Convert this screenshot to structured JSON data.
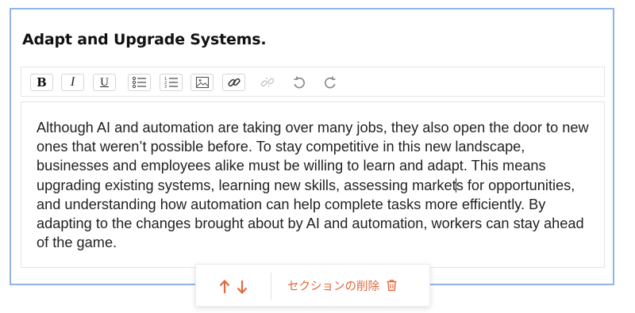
{
  "section": {
    "title": "Adapt and Upgrade Systems."
  },
  "toolbar": {
    "buttons": [
      {
        "name": "bold-button",
        "icon": "bold-icon",
        "label": "B"
      },
      {
        "name": "italic-button",
        "icon": "italic-icon",
        "label": "I"
      },
      {
        "name": "underline-button",
        "icon": "underline-icon",
        "label": "U"
      },
      {
        "name": "bullet-list-button",
        "icon": "bullet-list-icon"
      },
      {
        "name": "numbered-list-button",
        "icon": "numbered-list-icon"
      },
      {
        "name": "insert-image-button",
        "icon": "image-icon"
      },
      {
        "name": "insert-link-button",
        "icon": "link-icon"
      },
      {
        "name": "remove-link-button",
        "icon": "unlink-icon",
        "disabled": true
      },
      {
        "name": "undo-button",
        "icon": "undo-icon"
      },
      {
        "name": "redo-button",
        "icon": "redo-icon"
      }
    ]
  },
  "editor": {
    "text_before_caret": "Although AI and automation are taking over many jobs, they also open the door to new ones that weren’t possible before. To stay competitive in this new landscape, businesses and employees alike must be willing to learn and adapt. This means upgrading existing systems, learning new skills, assessing market",
    "text_after_caret": "s for opportunities, and understanding how automation can help complete tasks more efficiently. By adapting to the changes brought about by AI and automation, workers can stay ahead of the game."
  },
  "section_actions": {
    "move_up_icon": "arrow-up-icon",
    "move_down_icon": "arrow-down-icon",
    "delete_label": "セクションの削除",
    "delete_icon": "trash-icon"
  },
  "colors": {
    "accent": "#e2683e",
    "focus_border": "#8fb3ea",
    "disabled_icon": "#c4c4c4"
  }
}
